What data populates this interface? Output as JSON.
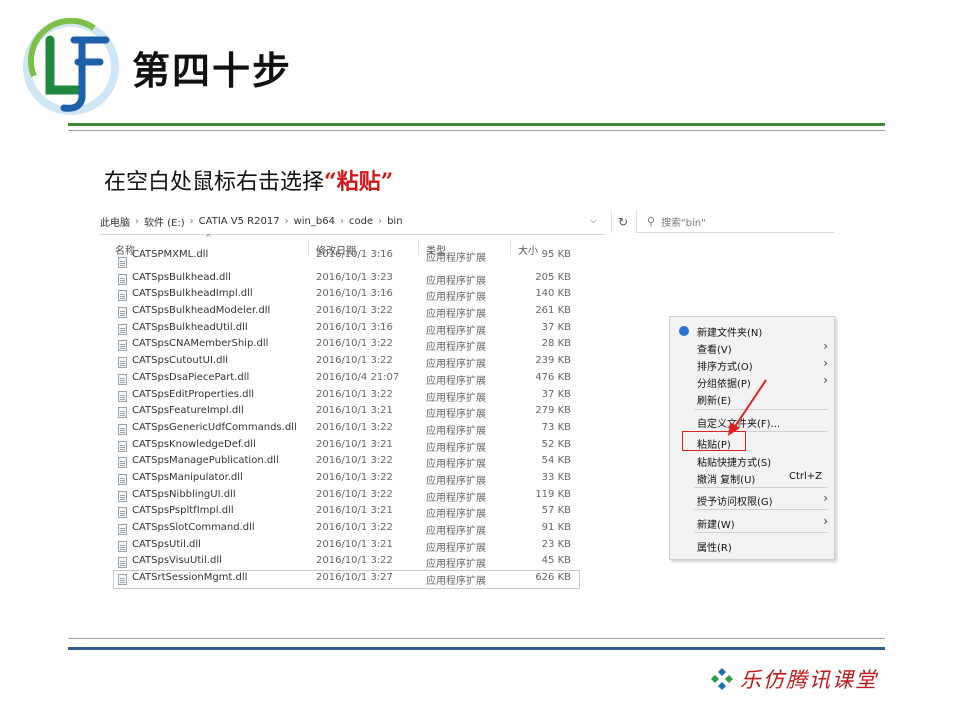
{
  "slide": {
    "title": "第四十步",
    "instruction_prefix": "在空白处鼠标右击选择",
    "instruction_highlight": "“粘贴”",
    "footer_brand": "乐仿腾讯课堂"
  },
  "explorer": {
    "breadcrumb": [
      "此电脑",
      "软件 (E:)",
      "CATIA V5 R2017",
      "win_b64",
      "code",
      "bin"
    ],
    "search_placeholder": "搜索\"bin\"",
    "columns": {
      "name": "名称",
      "date": "修改日期",
      "type": "类型",
      "size": "大小"
    },
    "files": [
      {
        "name": "CATSPMXML.dll",
        "date": "2016/10/1 3:16",
        "type": "应用程序扩展",
        "size": "95 KB"
      },
      {
        "name": "CATSpsBulkhead.dll",
        "date": "2016/10/1 3:23",
        "type": "应用程序扩展",
        "size": "205 KB"
      },
      {
        "name": "CATSpsBulkheadImpl.dll",
        "date": "2016/10/1 3:16",
        "type": "应用程序扩展",
        "size": "140 KB"
      },
      {
        "name": "CATSpsBulkheadModeler.dll",
        "date": "2016/10/1 3:22",
        "type": "应用程序扩展",
        "size": "261 KB"
      },
      {
        "name": "CATSpsBulkheadUtil.dll",
        "date": "2016/10/1 3:16",
        "type": "应用程序扩展",
        "size": "37 KB"
      },
      {
        "name": "CATSpsCNAMemberShip.dll",
        "date": "2016/10/1 3:22",
        "type": "应用程序扩展",
        "size": "28 KB"
      },
      {
        "name": "CATSpsCutoutUI.dll",
        "date": "2016/10/1 3:22",
        "type": "应用程序扩展",
        "size": "239 KB"
      },
      {
        "name": "CATSpsDsaPiecePart.dll",
        "date": "2016/10/4 21:07",
        "type": "应用程序扩展",
        "size": "476 KB"
      },
      {
        "name": "CATSpsEditProperties.dll",
        "date": "2016/10/1 3:22",
        "type": "应用程序扩展",
        "size": "37 KB"
      },
      {
        "name": "CATSpsFeatureImpl.dll",
        "date": "2016/10/1 3:21",
        "type": "应用程序扩展",
        "size": "279 KB"
      },
      {
        "name": "CATSpsGenericUdfCommands.dll",
        "date": "2016/10/1 3:22",
        "type": "应用程序扩展",
        "size": "73 KB"
      },
      {
        "name": "CATSpsKnowledgeDef.dll",
        "date": "2016/10/1 3:21",
        "type": "应用程序扩展",
        "size": "52 KB"
      },
      {
        "name": "CATSpsManagePublication.dll",
        "date": "2016/10/1 3:22",
        "type": "应用程序扩展",
        "size": "54 KB"
      },
      {
        "name": "CATSpsManipulator.dll",
        "date": "2016/10/1 3:22",
        "type": "应用程序扩展",
        "size": "33 KB"
      },
      {
        "name": "CATSpsNibblingUI.dll",
        "date": "2016/10/1 3:22",
        "type": "应用程序扩展",
        "size": "119 KB"
      },
      {
        "name": "CATSpsPspltfImpl.dll",
        "date": "2016/10/1 3:21",
        "type": "应用程序扩展",
        "size": "57 KB"
      },
      {
        "name": "CATSpsSlotCommand.dll",
        "date": "2016/10/1 3:22",
        "type": "应用程序扩展",
        "size": "91 KB"
      },
      {
        "name": "CATSpsUtil.dll",
        "date": "2016/10/1 3:21",
        "type": "应用程序扩展",
        "size": "23 KB"
      },
      {
        "name": "CATSpsVisuUtil.dll",
        "date": "2016/10/1 3:22",
        "type": "应用程序扩展",
        "size": "45 KB"
      },
      {
        "name": "CATSrtSessionMgmt.dll",
        "date": "2016/10/1 3:27",
        "type": "应用程序扩展",
        "size": "626 KB"
      }
    ]
  },
  "context_menu": {
    "new_folder": "新建文件夹(N)",
    "view": "查看(V)",
    "sort_by": "排序方式(O)",
    "group_by": "分组依据(P)",
    "refresh": "刷新(E)",
    "customize_folder": "自定义文件夹(F)...",
    "paste": "粘贴(P)",
    "paste_shortcut": "粘贴快捷方式(S)",
    "undo_copy": "撤消 复制(U)",
    "undo_shortcut": "Ctrl+Z",
    "grant_access": "授予访问权限(G)",
    "new": "新建(W)",
    "properties": "属性(R)"
  },
  "colors": {
    "accent_green": "#3f8a3a",
    "accent_blue": "#2e5f8f",
    "highlight_red": "#d01818",
    "menu_bg": "#f2f2f2"
  },
  "icons": [
    "lf-logo",
    "chevron-down-icon",
    "refresh-icon",
    "search-icon",
    "file-icon",
    "shield-icon",
    "chevron-right-icon",
    "red-arrow",
    "diamond-cluster-icon"
  ]
}
